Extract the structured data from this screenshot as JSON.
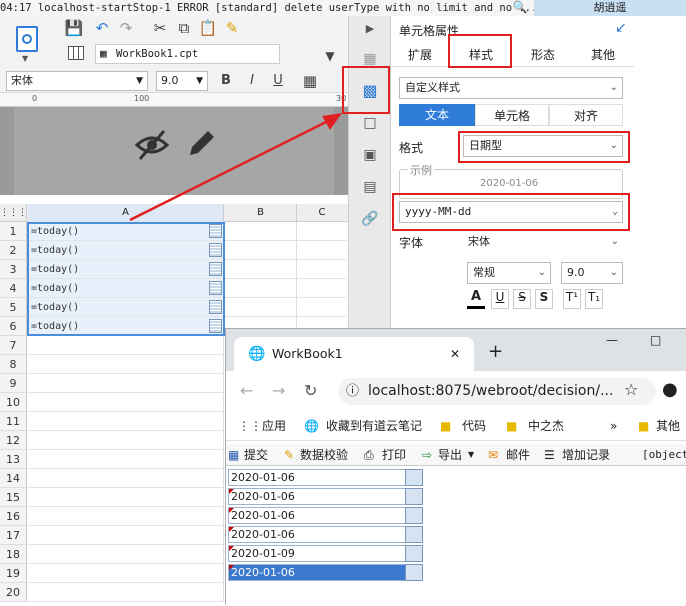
{
  "log": {
    "text": "04:17 localhost-startStop-1 ERROR [standard] delete userType with no limit and no ...",
    "user": "胡逍遥"
  },
  "editor": {
    "file_tab": "WorkBook1.cpt",
    "font_name": "宋体",
    "font_size": "9.0",
    "bold": "B",
    "italic": "I",
    "underline": "U",
    "ruler": [
      "0",
      "100",
      "30"
    ],
    "col_headers": [
      "A",
      "B",
      "C"
    ],
    "rows": [
      {
        "n": "1",
        "a": "=today()"
      },
      {
        "n": "2",
        "a": "=today()"
      },
      {
        "n": "3",
        "a": "=today()"
      },
      {
        "n": "4",
        "a": "=today()"
      },
      {
        "n": "5",
        "a": "=today()"
      },
      {
        "n": "6",
        "a": "=today()"
      },
      {
        "n": "7",
        "a": ""
      },
      {
        "n": "8",
        "a": ""
      },
      {
        "n": "9",
        "a": ""
      },
      {
        "n": "10",
        "a": ""
      },
      {
        "n": "11",
        "a": ""
      },
      {
        "n": "12",
        "a": ""
      },
      {
        "n": "13",
        "a": ""
      },
      {
        "n": "14",
        "a": ""
      },
      {
        "n": "15",
        "a": ""
      },
      {
        "n": "16",
        "a": ""
      },
      {
        "n": "17",
        "a": ""
      },
      {
        "n": "18",
        "a": ""
      },
      {
        "n": "19",
        "a": ""
      },
      {
        "n": "20",
        "a": ""
      }
    ]
  },
  "panel": {
    "title": "单元格属性",
    "tabs": [
      "扩展",
      "样式",
      "形态",
      "其他"
    ],
    "style_select": "自定义样式",
    "subtabs": [
      "文本",
      "单元格",
      "对齐"
    ],
    "format_label": "格式",
    "format_value": "日期型",
    "example_label": "示例",
    "example_value": "2020-01-06",
    "pattern_value": "yyyy-MM-dd",
    "font_label": "字体",
    "font_value": "宋体",
    "font_style": "常规",
    "font_size": "9.0",
    "deco": [
      "A",
      "U",
      "S",
      "S",
      "T¹",
      "T₁"
    ]
  },
  "browser": {
    "tab_title": "WorkBook1",
    "url": "localhost:8075/webroot/decision/...",
    "bookmarks": [
      "应用",
      "收藏到有道云笔记",
      "代码",
      "中之杰",
      "其他"
    ],
    "toolbar": [
      "提交",
      "数据校验",
      "打印",
      "导出",
      "邮件",
      "增加记录",
      "[object"
    ],
    "dates": [
      "2020-01-06",
      "2020-01-06",
      "2020-01-06",
      "2020-01-06",
      "2020-01-09",
      "2020-01-06"
    ]
  },
  "colors": {
    "accent": "#2f7bd8",
    "highlight": "#e02020",
    "selection": "#3b79cf"
  }
}
